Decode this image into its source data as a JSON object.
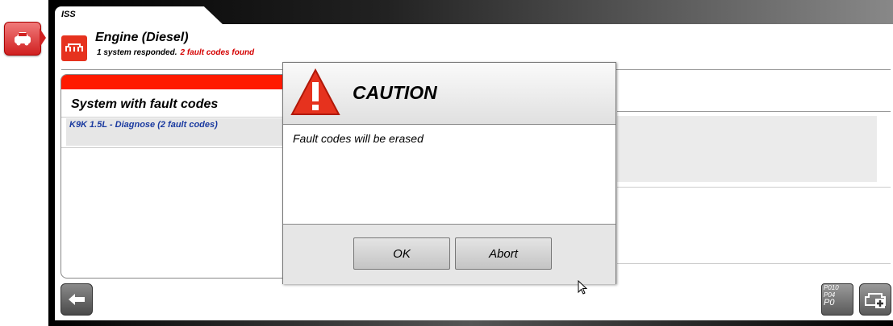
{
  "window": {
    "tab_label": "ISS"
  },
  "header": {
    "title": "Engine (Diesel)",
    "responded": "1 system responded.",
    "faults_found": "2 fault codes found",
    "icon": "engine-icon"
  },
  "systems_panel": {
    "title": "System with fault codes",
    "items": [
      {
        "label": "K9K 1.5L - Diagnose (2 fault codes)"
      }
    ]
  },
  "dialog": {
    "title": "CAUTION",
    "message": "Fault codes will be erased",
    "ok_label": "OK",
    "abort_label": "Abort",
    "icon": "warning-triangle-icon"
  },
  "toolbar": {
    "codes_lines": [
      "P010",
      "P04",
      "P0"
    ],
    "back_icon": "back-arrow-icon",
    "engine_add_icon": "engine-add-icon"
  },
  "colors": {
    "accent_red": "#e6321e",
    "link_blue": "#1a3aa0",
    "fault_red": "#d40000"
  }
}
